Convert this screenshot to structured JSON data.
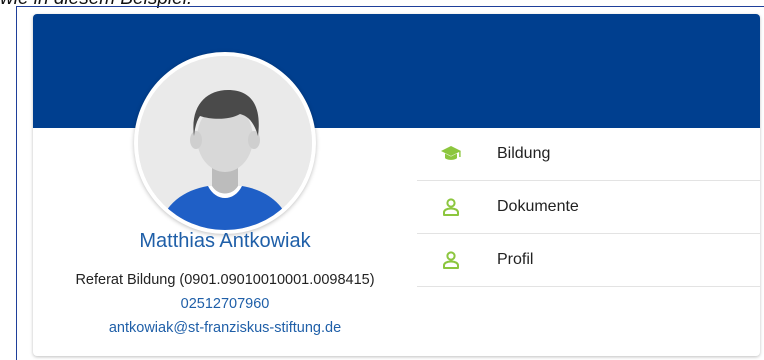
{
  "caption": "wie in diesem Beispiel:",
  "profile": {
    "name": "Matthias Antkowiak",
    "department": "Referat Bildung (0901.09010010001.0098415)",
    "phone": "02512707960",
    "email": "antkowiak@st-franziskus-stiftung.de"
  },
  "menu": {
    "items": [
      {
        "label": "Bildung",
        "icon": "graduation-cap-icon"
      },
      {
        "label": "Dokumente",
        "icon": "person-icon"
      },
      {
        "label": "Profil",
        "icon": "person-icon"
      }
    ]
  },
  "colors": {
    "banner": "#003f8f",
    "link": "#1f5fa8",
    "icon_green": "#8cc63e",
    "shirt": "#1f5fc6"
  }
}
